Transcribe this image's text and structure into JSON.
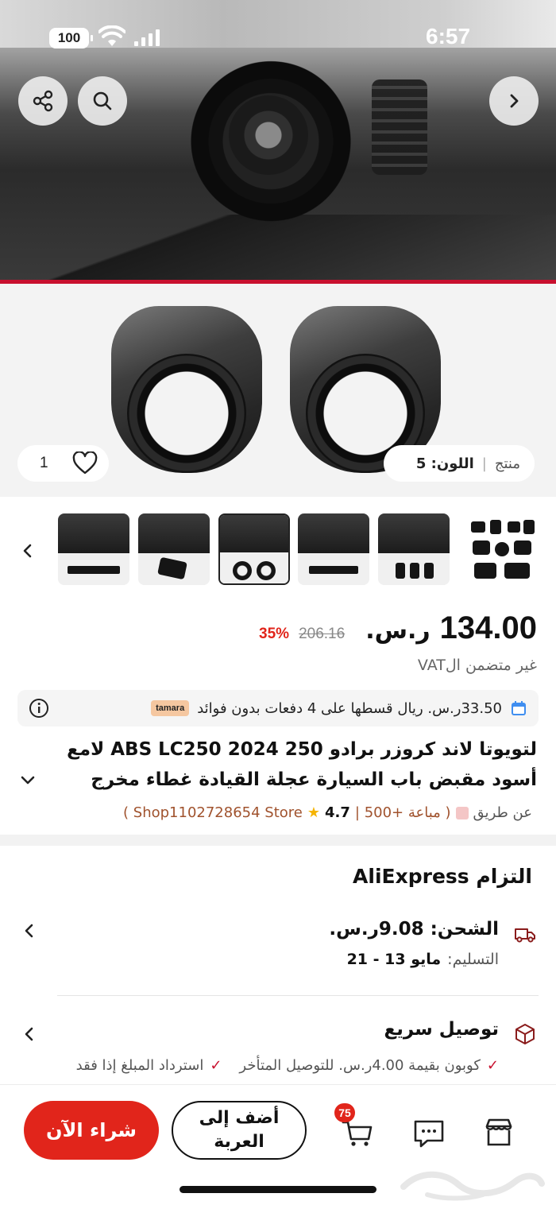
{
  "status_bar": {
    "battery": "100",
    "time": "6:57"
  },
  "gallery": {
    "like_count": "1",
    "variant_type": "منتج",
    "variant_label": "اللون: 5"
  },
  "price": {
    "current": "134.00",
    "currency": "ر.س.",
    "original": "206.16",
    "discount": "35%",
    "vat_note": "غير متضمن الVAT"
  },
  "installment": {
    "text": "33.50ر.س. ريال قسطها على 4 دفعات بدون فوائد",
    "provider": "tamara"
  },
  "product": {
    "title": "لتويوتا لاند كروزر برادو 250 ABS LC250 2024 لامع أسود مقبض باب السيارة عجلة القيادة غطاء مخرج"
  },
  "store": {
    "by": "عن طريق",
    "stats": "( مباعة +500 |",
    "rating": "4.7",
    "name": "Shop1102728654 Store )"
  },
  "commitment": {
    "title": "التزام AliExpress"
  },
  "shipping": {
    "label": "الشحن: 9.08ر.س.",
    "delivery_label": "التسليم:",
    "delivery_dates": "مايو 13 - 21"
  },
  "fast_delivery": {
    "label": "توصيل سريع",
    "perks": [
      "كوبون بقيمة 4.00ر.س. للتوصيل المتأخر",
      "استرداد المبلغ إذا فقد"
    ]
  },
  "bottom_bar": {
    "cart_count": "75",
    "add_to_cart": "أضف إلى العربة",
    "buy_now": "شراء الآن"
  },
  "colors": {
    "accent": "#e1251b",
    "brand_red": "#c8102e"
  }
}
